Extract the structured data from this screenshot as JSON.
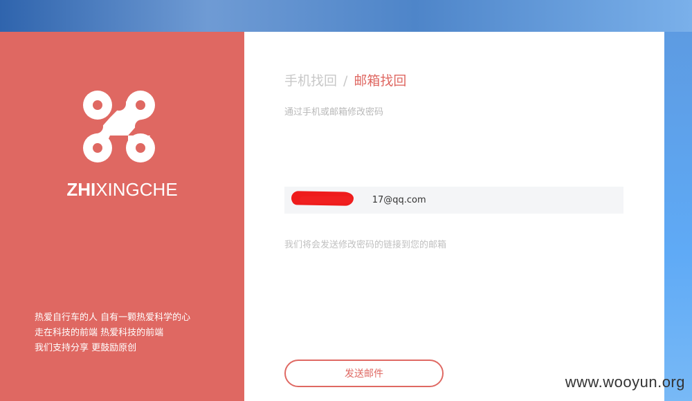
{
  "brand": {
    "logo_icon": "bike-chain-link-icon",
    "name_bold": "ZHI",
    "name_light": "XINGCHE"
  },
  "slogan": {
    "line1": "热爱自行车的人 自有一颗热爱科学的心",
    "line2": "走在科技的前端 热爱科技的前端",
    "line3": "我们支持分享 更鼓励原创"
  },
  "tabs": {
    "phone": "手机找回",
    "separator": "/",
    "email": "邮箱找回"
  },
  "subtitle": "通过手机或邮箱修改密码",
  "email_field": {
    "icon": "envelope-icon",
    "value": "17@qq.com"
  },
  "hint": "我们将会发送修改密码的链接到您的邮箱",
  "send_button": "发送邮件",
  "watermark": "www.wooyun.org",
  "colors": {
    "accent": "#df6862",
    "muted_text": "#c0c0c0",
    "input_bg": "#f4f5f7"
  }
}
